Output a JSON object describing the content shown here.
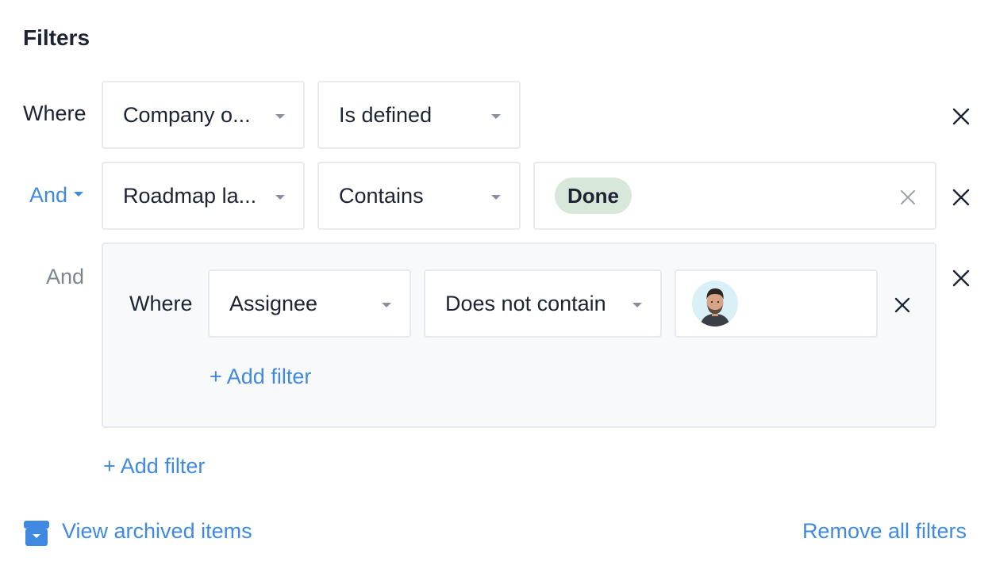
{
  "panel": {
    "title": "Filters"
  },
  "rows": [
    {
      "conjunction": "Where",
      "field": "Company o...",
      "operator": "Is defined"
    },
    {
      "conjunction": "And",
      "field": "Roadmap la...",
      "operator": "Contains",
      "value_tag": "Done"
    }
  ],
  "group": {
    "conjunction": "And",
    "row": {
      "conjunction": "Where",
      "field": "Assignee",
      "operator": "Does not contain",
      "value_icon": "user-avatar"
    },
    "add_filter_label": "+ Add filter"
  },
  "add_filter_label": "+ Add filter",
  "footer": {
    "view_archived_label": "View archived items",
    "remove_all_label": "Remove all filters"
  },
  "colors": {
    "accent": "#3f8ae0",
    "tag_bg": "#d7e8da",
    "border": "#e7e9ee",
    "group_bg": "#f8f9fb"
  }
}
